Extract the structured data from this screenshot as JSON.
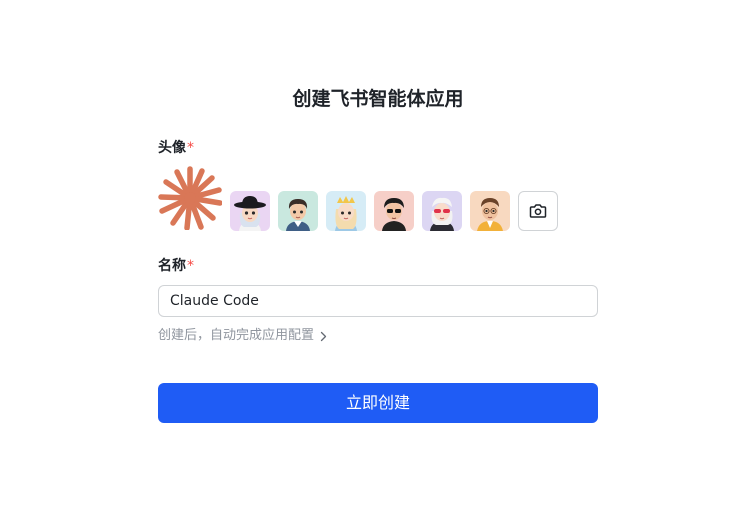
{
  "dialog": {
    "title": "创建飞书智能体应用",
    "avatar_label": "头像",
    "required_mark": "*",
    "name_label": "名称",
    "name_value": "Claude Code",
    "hint_text": "创建后，自动完成应用配置",
    "submit_label": "立即创建"
  },
  "avatars": {
    "selected": "claude-sunburst-icon",
    "selected_color": "#d97757",
    "options": [
      {
        "name": "avatar-girl-hat",
        "bg": "#ead6f3"
      },
      {
        "name": "avatar-boy-shirt",
        "bg": "#c9e8df"
      },
      {
        "name": "avatar-girl-crown",
        "bg": "#d6ecf6"
      },
      {
        "name": "avatar-boy-glasses",
        "bg": "#f6cfc8"
      },
      {
        "name": "avatar-girl-sunglasses",
        "bg": "#dcd6f3"
      },
      {
        "name": "avatar-boy-jacket",
        "bg": "#f8d9c0"
      }
    ],
    "upload_icon": "camera-icon"
  },
  "colors": {
    "primary": "#1f5cf5",
    "required": "#f54a45",
    "hint": "#8f959e"
  }
}
